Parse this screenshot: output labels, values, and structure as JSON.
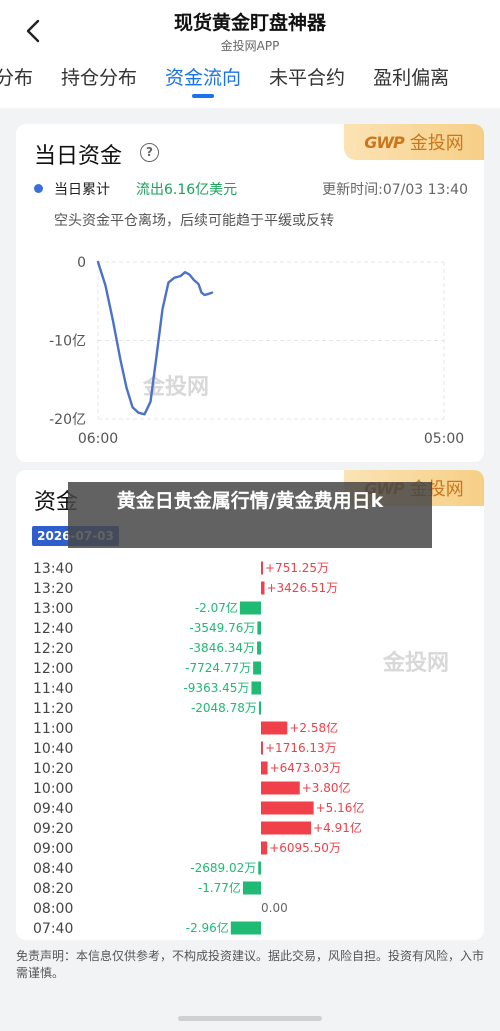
{
  "header": {
    "title": "现货黄金盯盘神器",
    "subtitle": "金投网APP",
    "back_icon": "chevron-left-icon"
  },
  "tabs": [
    {
      "label": "分布",
      "active": false
    },
    {
      "label": "持仓分布",
      "active": false
    },
    {
      "label": "资金流向",
      "active": true
    },
    {
      "label": "未平合约",
      "active": false
    },
    {
      "label": "盈利偏离",
      "active": false
    }
  ],
  "brand": {
    "mark": "GWP",
    "text": "金投网",
    "watermark": "金投网"
  },
  "daily_card": {
    "title": "当日资金",
    "help_icon": "?",
    "legend_label": "当日累计",
    "legend_value": "流出6.16亿美元",
    "update_time": "更新时间:07/03 13:40",
    "description": "空头资金平仓离场，后续可能趋于平缓或反转"
  },
  "bar_card": {
    "title": "资金",
    "date": "2026-07-03"
  },
  "overlay_text": "黄金日贵金属行情/黄金费用日k",
  "disclaimer": "免责声明：本信息仅供参考，不构成投资建议。据此交易，风险自担。投资有风险，入市需谨慎。",
  "colors": {
    "accent": "#1a73e8",
    "inflow": "#f0404a",
    "outflow": "#1fba74",
    "line": "#4a72c9"
  },
  "chart_data": [
    {
      "type": "line",
      "title": "当日资金",
      "series": [
        {
          "name": "当日累计",
          "values": [
            [
              0,
              0
            ],
            [
              5,
              -3.0
            ],
            [
              10,
              -7.5
            ],
            [
              15,
              -12.5
            ],
            [
              19,
              -16.0
            ],
            [
              23,
              -18.5
            ],
            [
              27,
              -19.2
            ],
            [
              31,
              -19.4
            ],
            [
              35,
              -17.8
            ],
            [
              39,
              -12.0
            ],
            [
              43,
              -6.0
            ],
            [
              47,
              -2.6
            ],
            [
              51,
              -2.0
            ],
            [
              55,
              -1.8
            ],
            [
              58,
              -1.3
            ],
            [
              61,
              -1.6
            ],
            [
              64,
              -2.3
            ],
            [
              67,
              -2.8
            ],
            [
              69,
              -3.9
            ],
            [
              71,
              -4.2
            ],
            [
              73,
              -4.1
            ],
            [
              76,
              -3.9
            ]
          ]
        }
      ],
      "x_labels": [
        "06:00",
        "05:00"
      ],
      "y_labels": [
        "0",
        "-10亿",
        "-20亿"
      ],
      "ylim": [
        -20,
        0
      ],
      "grid": true
    },
    {
      "type": "bar",
      "title": "资金",
      "categories": [
        "13:40",
        "13:20",
        "13:00",
        "12:40",
        "12:20",
        "12:00",
        "11:40",
        "11:20",
        "11:00",
        "10:40",
        "10:20",
        "10:00",
        "09:40",
        "09:20",
        "09:00",
        "08:40",
        "08:20",
        "08:00",
        "07:40"
      ],
      "values": [
        0.075125,
        0.342651,
        -2.07,
        -0.354976,
        -0.384634,
        -0.772477,
        -0.936345,
        -0.204878,
        2.58,
        0.171613,
        0.647303,
        3.8,
        5.16,
        4.91,
        0.60955,
        -0.268902,
        -1.77,
        0,
        -2.96
      ],
      "labels": [
        "+751.25万",
        "+3426.51万",
        "-2.07亿",
        "-3549.76万",
        "-3846.34万",
        "-7724.77万",
        "-9363.45万",
        "-2048.78万",
        "+2.58亿",
        "+1716.13万",
        "+6473.03万",
        "+3.80亿",
        "+5.16亿",
        "+4.91亿",
        "+6095.50万",
        "-2689.02万",
        "-1.77亿",
        "0.00",
        "-2.96亿"
      ],
      "unit": "亿"
    }
  ]
}
